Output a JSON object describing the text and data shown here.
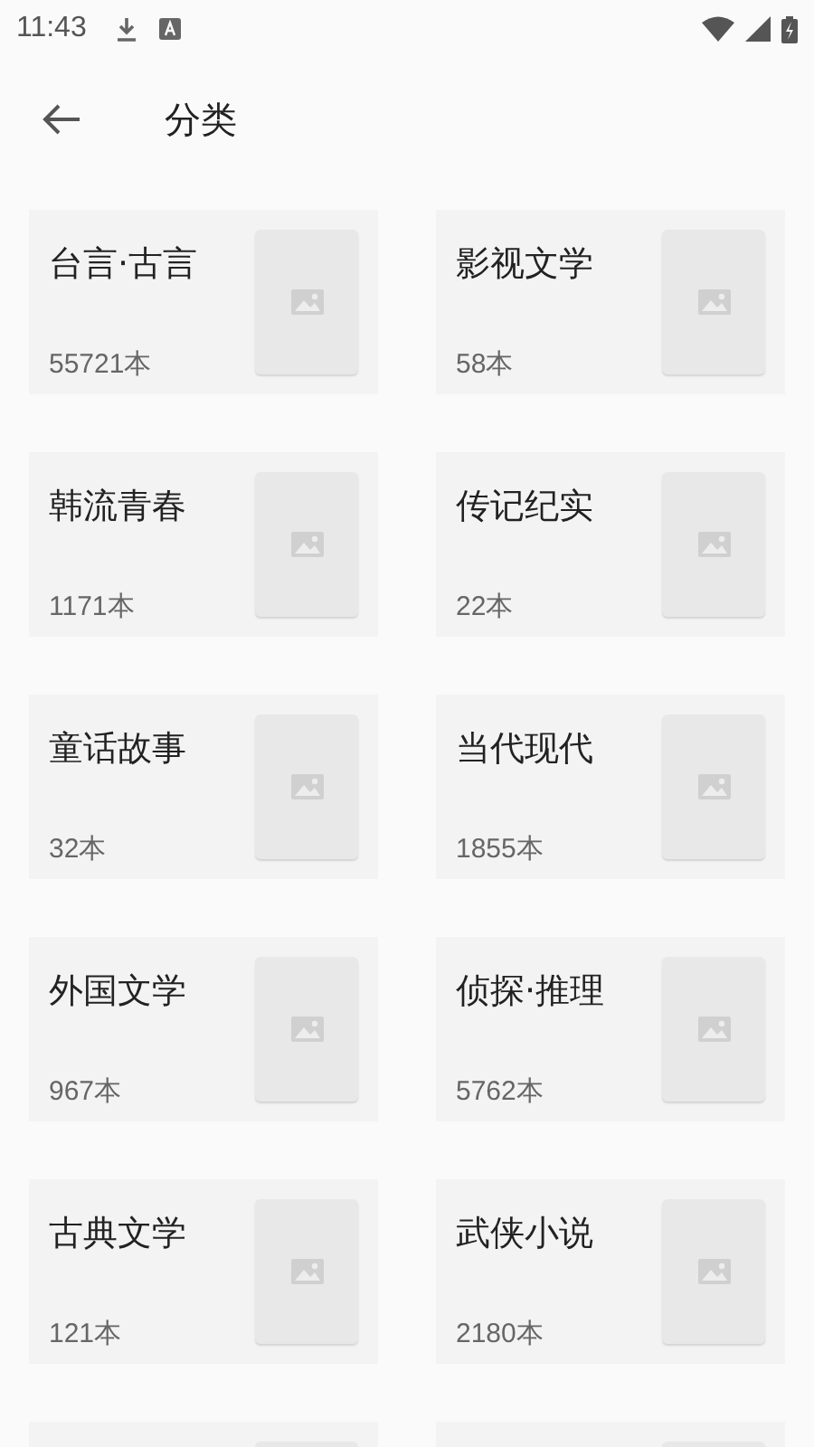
{
  "status_bar": {
    "time": "11:43"
  },
  "toolbar": {
    "title": "分类"
  },
  "categories": [
    {
      "kind": "card",
      "title": "台言·古言",
      "count": "55721本"
    },
    {
      "kind": "card",
      "title": "影视文学",
      "count": "58本"
    },
    {
      "kind": "card",
      "title": "韩流青春",
      "count": "1171本"
    },
    {
      "kind": "card",
      "title": "传记纪实",
      "count": "22本"
    },
    {
      "kind": "card",
      "title": "童话故事",
      "count": "32本"
    },
    {
      "kind": "card",
      "title": "当代现代",
      "count": "1855本"
    },
    {
      "kind": "card",
      "title": "外国文学",
      "count": "967本"
    },
    {
      "kind": "card",
      "title": "侦探·推理",
      "count": "5762本"
    },
    {
      "kind": "card",
      "title": "古典文学",
      "count": "121本"
    },
    {
      "kind": "card",
      "title": "武侠小说",
      "count": "2180本"
    },
    {
      "kind": "partial"
    },
    {
      "kind": "partial"
    }
  ]
}
